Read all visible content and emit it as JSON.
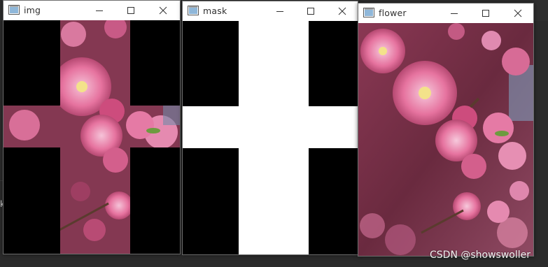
{
  "windows": [
    {
      "id": "img",
      "title": "img"
    },
    {
      "id": "mask",
      "title": "mask"
    },
    {
      "id": "flower",
      "title": "flower"
    }
  ],
  "controls": {
    "minimize": "minimize-icon",
    "maximize": "maximize-icon",
    "close": "close-icon"
  },
  "background": {
    "edge_char": "k"
  },
  "watermark": "CSDN @showswoller",
  "colors": {
    "mask_on": "#ffffff",
    "mask_off": "#000000",
    "blossom_pink": "#e77aa5",
    "titlebar": "#ffffff"
  }
}
